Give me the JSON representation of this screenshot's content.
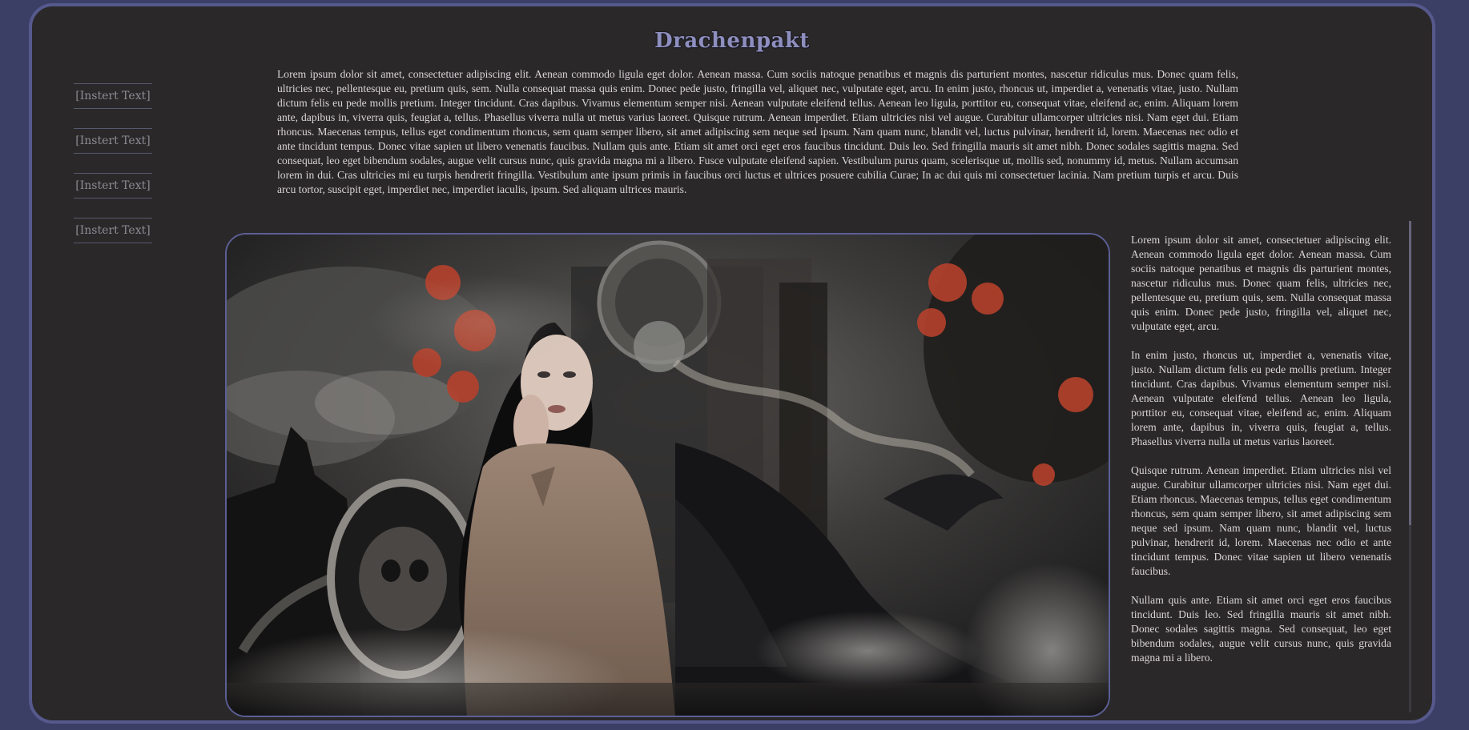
{
  "header": {
    "title": "Drachenpakt"
  },
  "nav": {
    "items": [
      {
        "label": "[Instert Text]"
      },
      {
        "label": "[Instert Text]"
      },
      {
        "label": "[Instert Text]"
      },
      {
        "label": "[Instert Text]"
      }
    ]
  },
  "intro": {
    "text": "Lorem ipsum dolor sit amet, consectetuer adipiscing elit. Aenean commodo ligula eget dolor. Aenean massa. Cum sociis natoque penatibus et magnis dis parturient montes, nascetur ridiculus mus. Donec quam felis, ultricies nec, pellentesque eu, pretium quis, sem. Nulla consequat massa quis enim. Donec pede justo, fringilla vel, aliquet nec, vulputate eget, arcu. In enim justo, rhoncus ut, imperdiet a, venenatis vitae, justo. Nullam dictum felis eu pede mollis pretium. Integer tincidunt. Cras dapibus. Vivamus elementum semper nisi. Aenean vulputate eleifend tellus. Aenean leo ligula, porttitor eu, consequat vitae, eleifend ac, enim. Aliquam lorem ante, dapibus in, viverra quis, feugiat a, tellus. Phasellus viverra nulla ut metus varius laoreet. Quisque rutrum. Aenean imperdiet. Etiam ultricies nisi vel augue. Curabitur ullamcorper ultricies nisi. Nam eget dui. Etiam rhoncus. Maecenas tempus, tellus eget condimentum rhoncus, sem quam semper libero, sit amet adipiscing sem neque sed ipsum. Nam quam nunc, blandit vel, luctus pulvinar, hendrerit id, lorem. Maecenas nec odio et ante tincidunt tempus. Donec vitae sapien ut libero venenatis faucibus. Nullam quis ante. Etiam sit amet orci eget eros faucibus tincidunt. Duis leo. Sed fringilla mauris sit amet nibh. Donec sodales sagittis magna. Sed consequat, leo eget bibendum sodales, augue velit cursus nunc, quis gravida magna mi a libero. Fusce vulputate eleifend sapien. Vestibulum purus quam, scelerisque ut, mollis sed, nonummy id, metus. Nullam accumsan lorem in dui. Cras ultricies mi eu turpis hendrerit fringilla. Vestibulum ante ipsum primis in faucibus orci luctus et ultrices posuere cubilia Curae; In ac dui quis mi consectetuer lacinia. Nam pretium turpis et arcu. Duis arcu tortor, suscipit eget, imperdiet nec, imperdiet iaculis, ipsum. Sed aliquam ultrices mauris."
  },
  "sidebar": {
    "paragraphs": [
      "Lorem ipsum dolor sit amet, consectetuer adipiscing elit. Aenean commodo ligula eget dolor. Aenean massa. Cum sociis natoque penatibus et magnis dis parturient montes, nascetur ridiculus mus. Donec quam felis, ultricies nec, pellentesque eu, pretium quis, sem. Nulla consequat massa quis enim. Donec pede justo, fringilla vel, aliquet nec, vulputate eget, arcu.",
      "In enim justo, rhoncus ut, imperdiet a, venenatis vitae, justo. Nullam dictum felis eu pede mollis pretium. Integer tincidunt. Cras dapibus. Vivamus elementum semper nisi. Aenean vulputate eleifend tellus. Aenean leo ligula, porttitor eu, consequat vitae, eleifend ac, enim. Aliquam lorem ante, dapibus in, viverra quis, feugiat a, tellus. Phasellus viverra nulla ut metus varius laoreet.",
      "Quisque rutrum. Aenean imperdiet. Etiam ultricies nisi vel augue. Curabitur ullamcorper ultricies nisi. Nam eget dui. Etiam rhoncus. Maecenas tempus, tellus eget condimentum rhoncus, sem quam semper libero, sit amet adipiscing sem neque sed ipsum. Nam quam nunc, blandit vel, luctus pulvinar, hendrerit id, lorem. Maecenas nec odio et ante tincidunt tempus. Donec vitae sapien ut libero venenatis faucibus.",
      "Nullam quis ante. Etiam sit amet orci eget eros faucibus tincidunt. Duis leo. Sed fringilla mauris sit amet nibh. Donec sodales sagittis magna. Sed consequat, leo eget bibendum sodales, augue velit cursus nunc, quis gravida magna mi a libero."
    ]
  },
  "colors": {
    "page_background": "#3b3f66",
    "panel_background": "#2a2829",
    "border_accent": "#56598c",
    "title_color": "#8e8fbf",
    "body_text": "#d9d4d8"
  }
}
